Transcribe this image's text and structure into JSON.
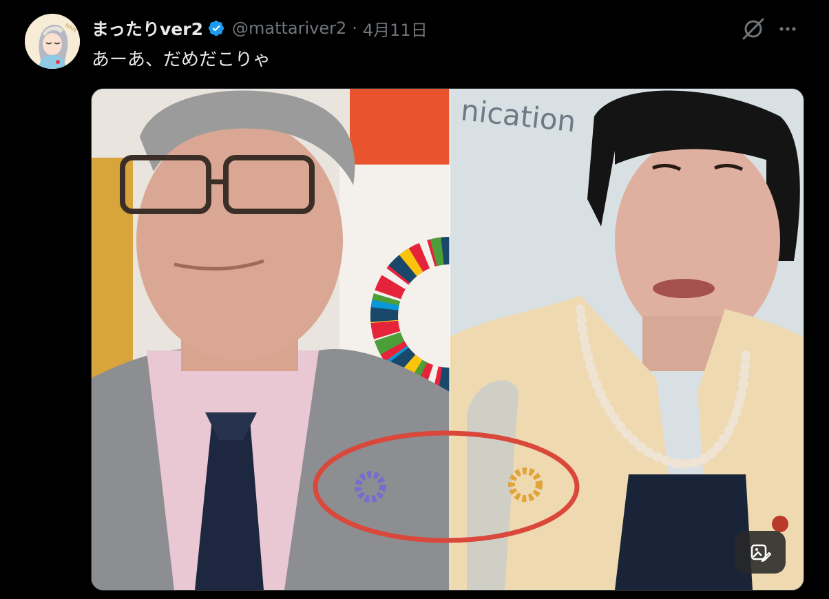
{
  "post": {
    "author": {
      "display_name": "まったりver2",
      "handle": "@mattariver2",
      "verified": true,
      "avatar_icon": "avatar-illustration"
    },
    "separator": "·",
    "date": "4月11日",
    "text": "あーあ、だめだこりゃ",
    "actions": {
      "grok_icon": "grok-icon",
      "more_icon": "more-icon"
    },
    "media": {
      "type": "photo",
      "background_text": "nication",
      "edit_button_icon": "image-edit-icon"
    }
  },
  "colors": {
    "background": "#000000",
    "text_primary": "#e7e9ea",
    "text_secondary": "#71767b",
    "verified_blue": "#1d9bf0",
    "highlight_circle": "#d9483b"
  }
}
